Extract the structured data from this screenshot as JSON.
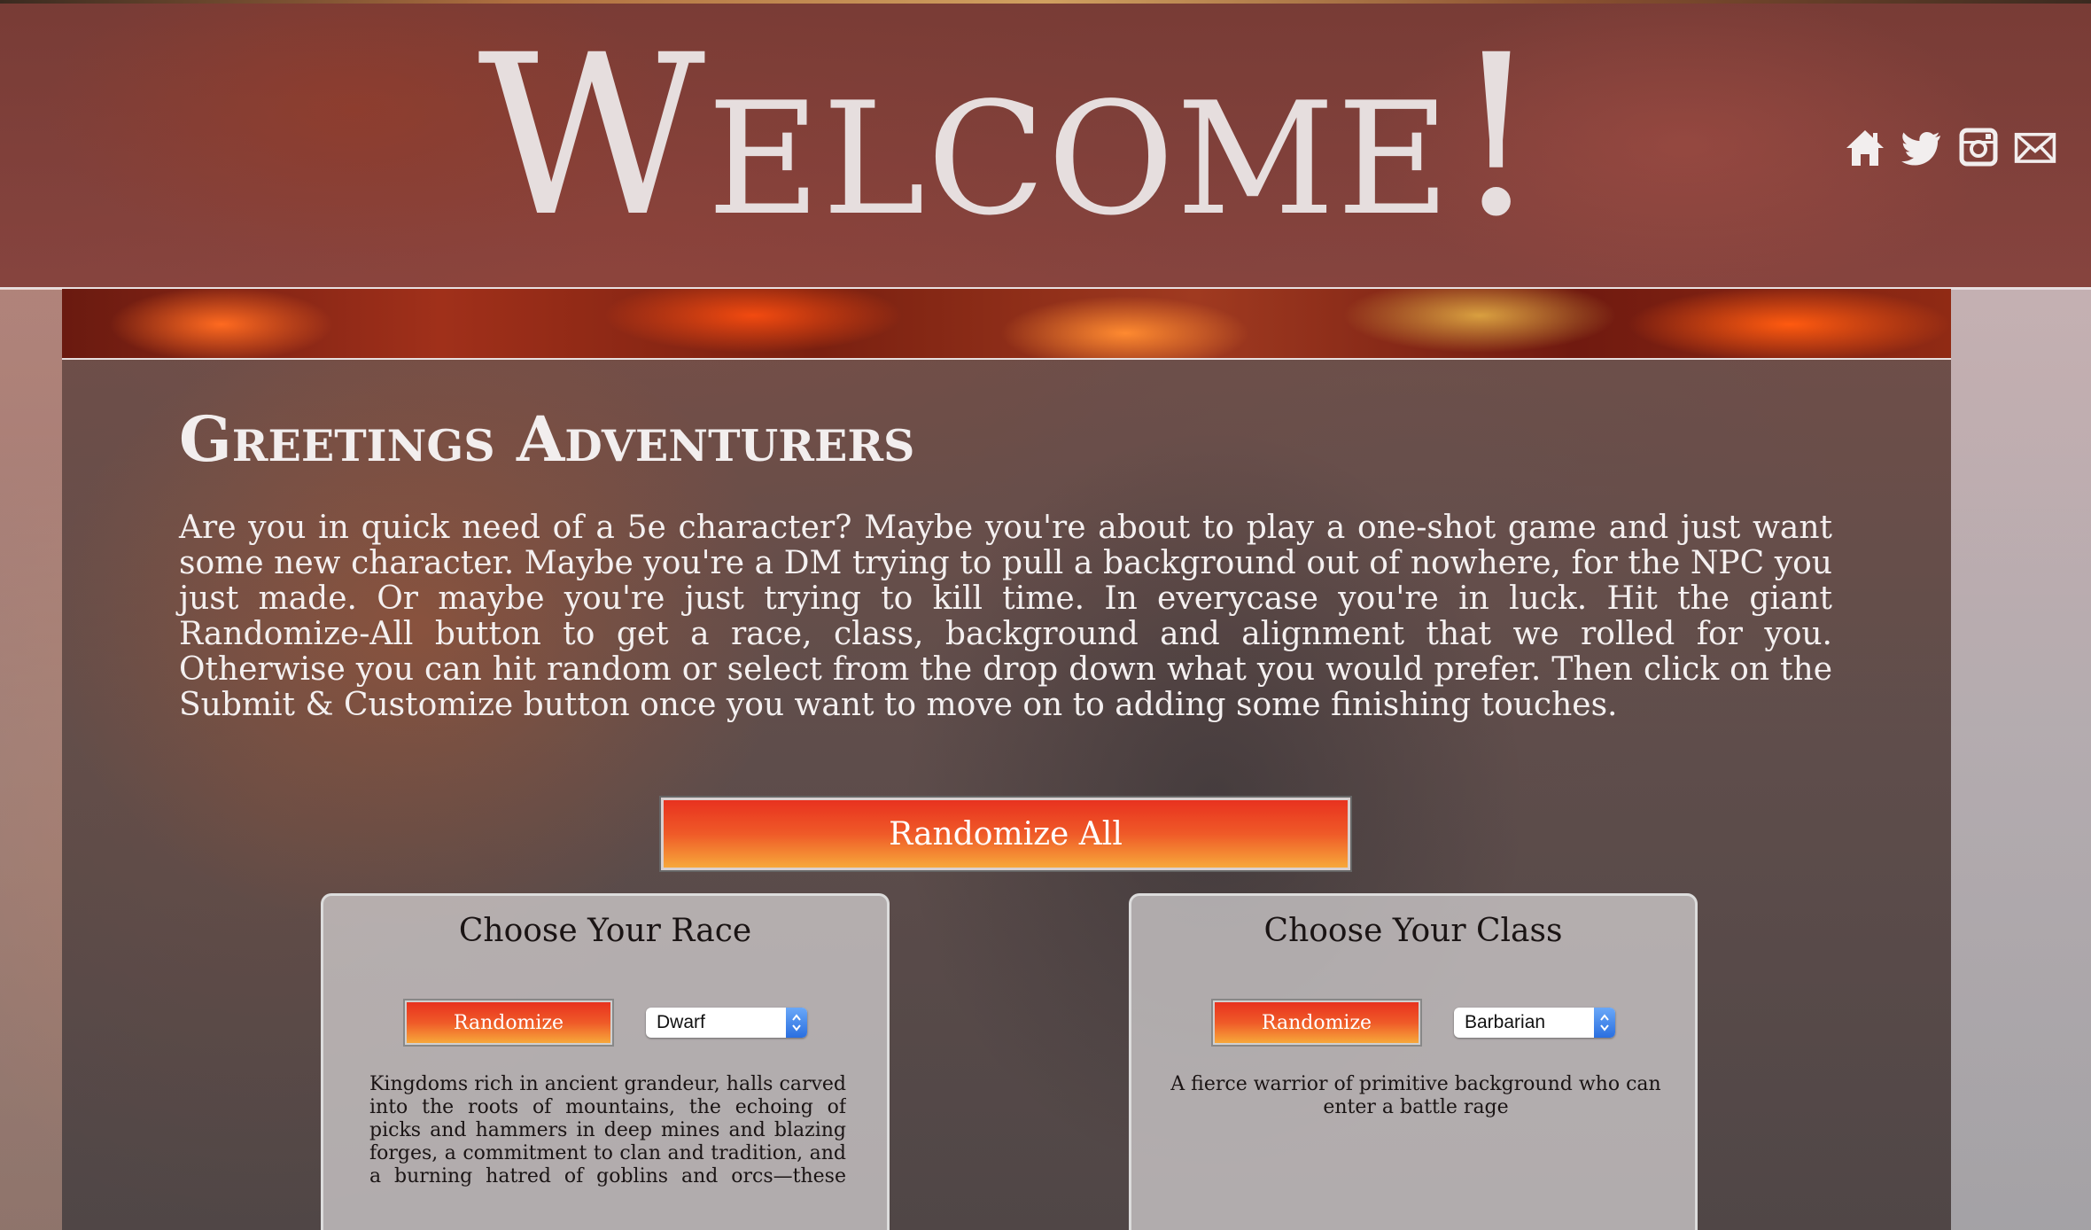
{
  "header": {
    "title": "Welcome!",
    "social": [
      {
        "icon": "home-icon"
      },
      {
        "icon": "twitter-icon"
      },
      {
        "icon": "instagram-icon"
      },
      {
        "icon": "mail-icon"
      }
    ]
  },
  "main": {
    "heading": "Greetings Adventurers",
    "intro": "Are you in quick need of a 5e character? Maybe you're about to play a one-shot game and just want some new character. Maybe you're a DM trying to pull a background out of nowhere, for the NPC you just made. Or maybe you're just trying to kill time. In everycase you're in luck. Hit the giant Randomize-All button to get a race, class, background and alignment that we rolled for you. Otherwise you can hit random or select from the drop down what you would prefer. Then click on the Submit & Customize button once you want to move on to adding some finishing touches.",
    "randomize_all_label": "Randomize All"
  },
  "race_card": {
    "title": "Choose Your Race",
    "randomize_label": "Randomize",
    "selected": "Dwarf",
    "description": "Kingdoms rich in ancient grandeur, halls carved into the roots of mountains, the echoing of picks and hammers in deep mines and blazing forges, a commitment to clan and tradition, and a burning hatred of goblins and orcs—these common"
  },
  "class_card": {
    "title": "Choose Your Class",
    "randomize_label": "Randomize",
    "selected": "Barbarian",
    "description": "A fierce warrior of primitive background who can enter a battle rage"
  },
  "colors": {
    "button_top": "#e8321f",
    "button_bottom": "#f7a83a",
    "title_text": "#e6dede",
    "select_arrow": "#2a6fe0"
  }
}
